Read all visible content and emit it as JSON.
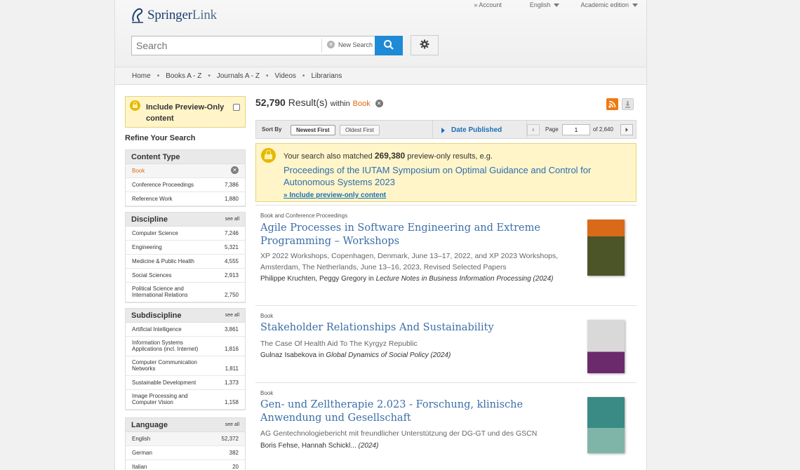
{
  "header": {
    "logo_brand": "Springer",
    "logo_product": "Link",
    "account": "» Account",
    "language": "English",
    "edition": "Academic edition",
    "search_placeholder": "Search",
    "new_search": "New Search"
  },
  "nav": [
    "Home",
    "Books A - Z",
    "Journals A - Z",
    "Videos",
    "Librarians"
  ],
  "sidebar": {
    "preview_label": "Include Preview-Only content",
    "refine": "Refine Your Search",
    "see_all": "see all",
    "content_type": {
      "title": "Content Type",
      "items": [
        {
          "name": "Book",
          "count": ""
        },
        {
          "name": "Conference Proceedings",
          "count": "7,386"
        },
        {
          "name": "Reference Work",
          "count": "1,880"
        }
      ]
    },
    "discipline": {
      "title": "Discipline",
      "items": [
        {
          "name": "Computer Science",
          "count": "7,246"
        },
        {
          "name": "Engineering",
          "count": "5,321"
        },
        {
          "name": "Medicine & Public Health",
          "count": "4,555"
        },
        {
          "name": "Social Sciences",
          "count": "2,913"
        },
        {
          "name": "Political Science and International Relations",
          "count": "2,750"
        }
      ]
    },
    "subdiscipline": {
      "title": "Subdiscipline",
      "items": [
        {
          "name": "Artificial Intelligence",
          "count": "3,861"
        },
        {
          "name": "Information Systems Applications (incl. Internet)",
          "count": "1,816"
        },
        {
          "name": "Computer Communication Networks",
          "count": "1,811"
        },
        {
          "name": "Sustainable Development",
          "count": "1,373"
        },
        {
          "name": "Image Processing and Computer Vision",
          "count": "1,158"
        }
      ]
    },
    "language": {
      "title": "Language",
      "items": [
        {
          "name": "English",
          "count": "52,372"
        },
        {
          "name": "German",
          "count": "382"
        },
        {
          "name": "Italian",
          "count": "20"
        }
      ]
    }
  },
  "results": {
    "count": "52,790",
    "results_label": "Result(s)",
    "within": "within",
    "within_value": "Book",
    "sort_by": "Sort By",
    "newest_first": "Newest First",
    "oldest_first": "Oldest First",
    "date_published": "Date Published",
    "page_label": "Page",
    "page_value": "1",
    "page_of": "of 2,640",
    "matched_prefix": "Your search also matched",
    "matched_count": "269,380",
    "matched_suffix": "preview-only results, e.g.",
    "matched_title": "Proceedings of the IUTAM Symposium on Optimal Guidance and Control for Autonomous Systems 2023",
    "include_link": "» Include preview-only content",
    "items": [
      {
        "type": "Book and Conference Proceedings",
        "title": "Agile Processes in Software Engineering and Extreme Programming – Workshops",
        "subtitle": "XP 2022 Workshops, Copenhagen, Denmark, June 13–17, 2022, and XP 2023 Workshops, Amsterdam, The Netherlands, June 13–16, 2023, Revised Selected Papers",
        "authors": "Philippe Kruchten, Peggy Gregory",
        "in": "in",
        "series": "Lecture Notes in Business Information Processing (2024)"
      },
      {
        "type": "Book",
        "title": "Stakeholder Relationships And Sustainability",
        "subtitle": "The Case Of Health Aid To The Kyrgyz Republic",
        "authors": "Gulnaz Isabekova",
        "in": "in",
        "series": "Global Dynamics of Social Policy (2024)"
      },
      {
        "type": "Book",
        "title": "Gen- und Zelltherapie 2.023 - Forschung, klinische Anwendung und Gesellschaft",
        "subtitle": "AG Gentechnologiebericht mit freundlicher Unterstützung der DG-GT und des GSCN",
        "authors": "Boris Fehse, Hannah Schickl...",
        "in": "",
        "series": "(2024)"
      }
    ]
  }
}
